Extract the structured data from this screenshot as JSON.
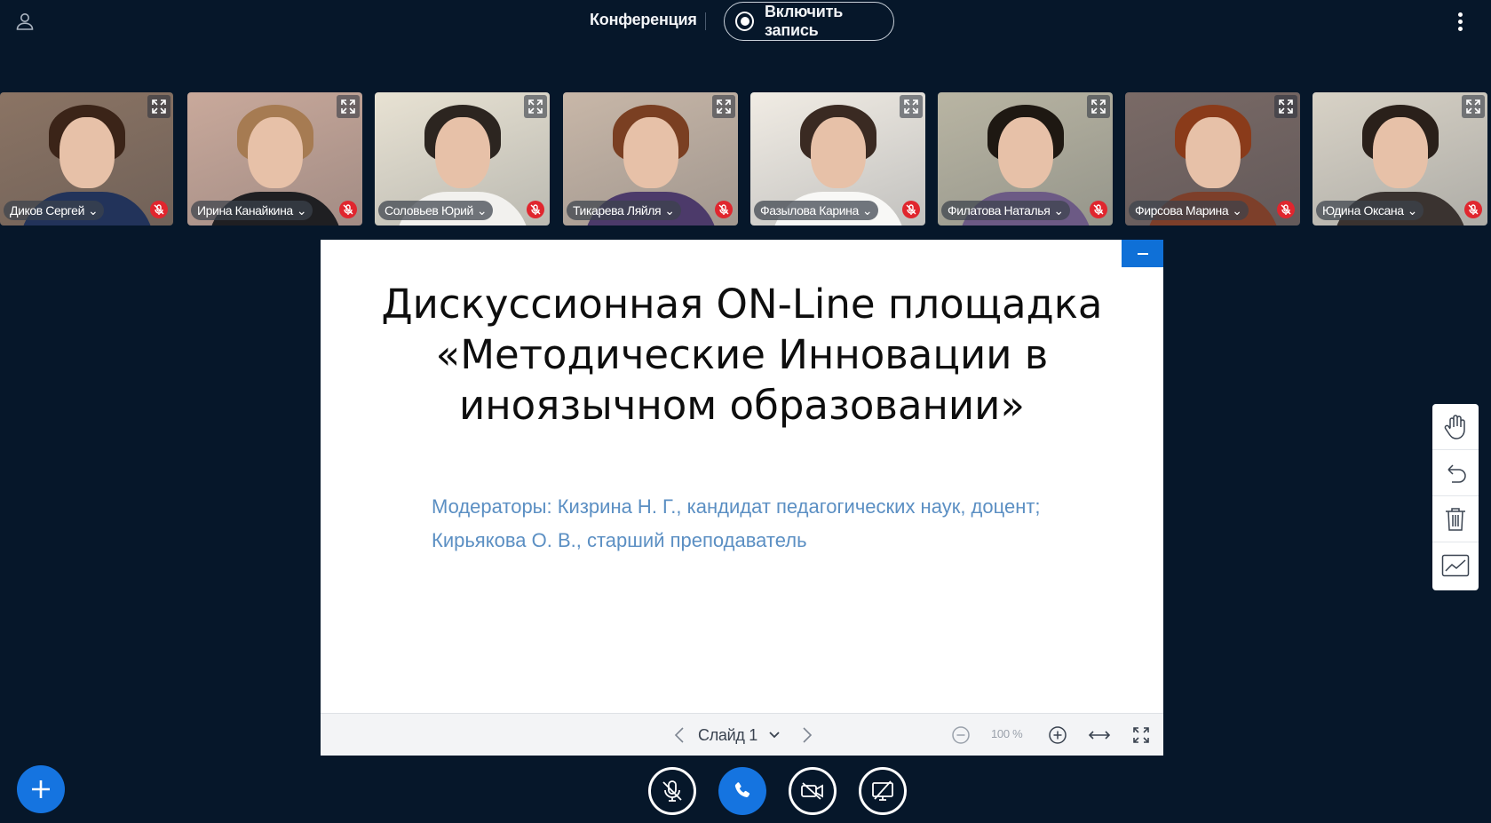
{
  "header": {
    "title": "Конференция",
    "record_label": "Включить запись",
    "icons": {
      "user": "user-icon",
      "record": "record-icon",
      "more": "more-vertical-icon"
    }
  },
  "participants": [
    {
      "name": "Диков Сергей",
      "muted": true
    },
    {
      "name": "Ирина Канайкина",
      "muted": true
    },
    {
      "name": "Соловьев Юрий",
      "muted": true
    },
    {
      "name": "Тикарева Ляйля",
      "muted": true
    },
    {
      "name": "Фазылова Карина",
      "muted": true
    },
    {
      "name": "Филатова Наталья",
      "muted": true
    },
    {
      "name": "Фирсова Марина",
      "muted": true
    },
    {
      "name": "Юдина Оксана",
      "muted": true
    }
  ],
  "presentation": {
    "title": "Дискуссионная ON-Line площадка «Методические Инновации в иноязычном образовании»",
    "subtitle_line1": "Модераторы: Кизрина Н. Г., кандидат педагогических наук, доцент;",
    "subtitle_line2": "Кирьякова О. В., старший преподаватель",
    "slide_label": "Слайд 1",
    "zoom": "100 %"
  },
  "whiteboard_tools": [
    "hand-icon",
    "undo-icon",
    "trash-icon",
    "chart-icon"
  ],
  "controls": [
    "mic-muted-icon",
    "phone-icon",
    "camera-off-icon",
    "screenshare-off-icon"
  ],
  "colors": {
    "background": "#06172a",
    "accent": "#1574e0",
    "mute_badge": "#e0262e",
    "subtitle": "#5b8fc3"
  }
}
